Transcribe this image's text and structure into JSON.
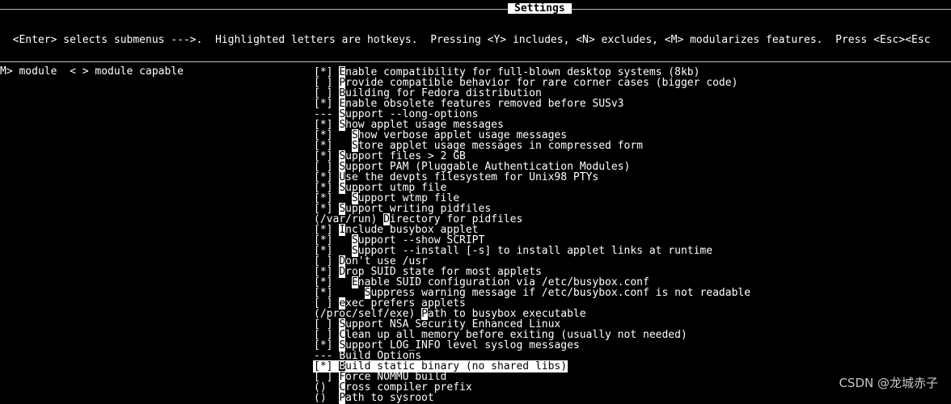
{
  "window": {
    "title": "Settings"
  },
  "help": {
    "line1": "  <Enter> selects submenus --->.  Highlighted letters are hotkeys.  Pressing <Y> includes, <N> excludes, <M> modularizes features.  Press <Esc><Esc",
    "line2": "M> module  < > module capable"
  },
  "menu": {
    "items": [
      {
        "prefix": "[*] ",
        "hotkey": "E",
        "rest": "nable compatibility for full-blown desktop systems (8kb)"
      },
      {
        "prefix": "[ ] ",
        "hotkey": "P",
        "rest": "rovide compatible behavior for rare corner cases (bigger code)"
      },
      {
        "prefix": "[ ] ",
        "hotkey": "B",
        "rest": "uilding for Fedora distribution"
      },
      {
        "prefix": "[*] ",
        "hotkey": "E",
        "rest": "nable obsolete features removed before SUSv3"
      },
      {
        "prefix": "--- ",
        "hotkey": "S",
        "rest": "upport --long-options"
      },
      {
        "prefix": "[*] ",
        "hotkey": "S",
        "rest": "how applet usage messages"
      },
      {
        "prefix": "[*]   ",
        "hotkey": "S",
        "rest": "how verbose applet usage messages"
      },
      {
        "prefix": "[*]   ",
        "hotkey": "S",
        "rest": "tore applet usage messages in compressed form"
      },
      {
        "prefix": "[*] ",
        "hotkey": "S",
        "rest": "upport files > 2 GB"
      },
      {
        "prefix": "[ ] ",
        "hotkey": "S",
        "rest": "upport PAM (Pluggable Authentication Modules)"
      },
      {
        "prefix": "[*] ",
        "hotkey": "U",
        "rest": "se the devpts filesystem for Unix98 PTYs"
      },
      {
        "prefix": "[*] ",
        "hotkey": "S",
        "rest": "upport utmp file"
      },
      {
        "prefix": "[*]   ",
        "hotkey": "S",
        "rest": "upport wtmp file"
      },
      {
        "prefix": "[*] ",
        "hotkey": "S",
        "rest": "upport writing pidfiles"
      },
      {
        "prefix": "(/var/run) ",
        "hotkey": "D",
        "rest": "irectory for pidfiles"
      },
      {
        "prefix": "[*] ",
        "hotkey": "I",
        "rest": "nclude busybox applet"
      },
      {
        "prefix": "[*]   ",
        "hotkey": "S",
        "rest": "upport --show SCRIPT"
      },
      {
        "prefix": "[*]   ",
        "hotkey": "S",
        "rest": "upport --install [-s] to install applet links at runtime"
      },
      {
        "prefix": "[ ] ",
        "hotkey": "D",
        "rest": "on't use /usr"
      },
      {
        "prefix": "[*] ",
        "hotkey": "D",
        "rest": "rop SUID state for most applets"
      },
      {
        "prefix": "[*]   ",
        "hotkey": "E",
        "rest": "nable SUID configuration via /etc/busybox.conf"
      },
      {
        "prefix": "[*]     ",
        "hotkey": "S",
        "rest": "uppress warning message if /etc/busybox.conf is not readable"
      },
      {
        "prefix": "[ ] ",
        "hotkey": "e",
        "rest": "xec prefers applets"
      },
      {
        "prefix": "(/proc/self/exe) ",
        "hotkey": "P",
        "rest": "ath to busybox executable"
      },
      {
        "prefix": "[ ] ",
        "hotkey": "S",
        "rest": "upport NSA Security Enhanced Linux"
      },
      {
        "prefix": "[ ] ",
        "hotkey": "C",
        "rest": "lean up all memory before exiting (usually not needed)"
      },
      {
        "prefix": "[*] ",
        "hotkey": "S",
        "rest": "upport LOG_INFO level syslog messages"
      },
      {
        "prefix": "--- ",
        "hotkey": "",
        "rest": "Build Options"
      },
      {
        "prefix": "[*] ",
        "hotkey": "B",
        "rest": "uild static binary (no shared libs)",
        "selected": true
      },
      {
        "prefix": "[ ] ",
        "hotkey": "F",
        "rest": "orce NOMMU build"
      },
      {
        "prefix": "()  ",
        "hotkey": "C",
        "rest": "ross compiler prefix"
      },
      {
        "prefix": "()  ",
        "hotkey": "P",
        "rest": "ath to sysroot"
      }
    ]
  },
  "watermark": {
    "text": "CSDN @龙城赤子"
  }
}
